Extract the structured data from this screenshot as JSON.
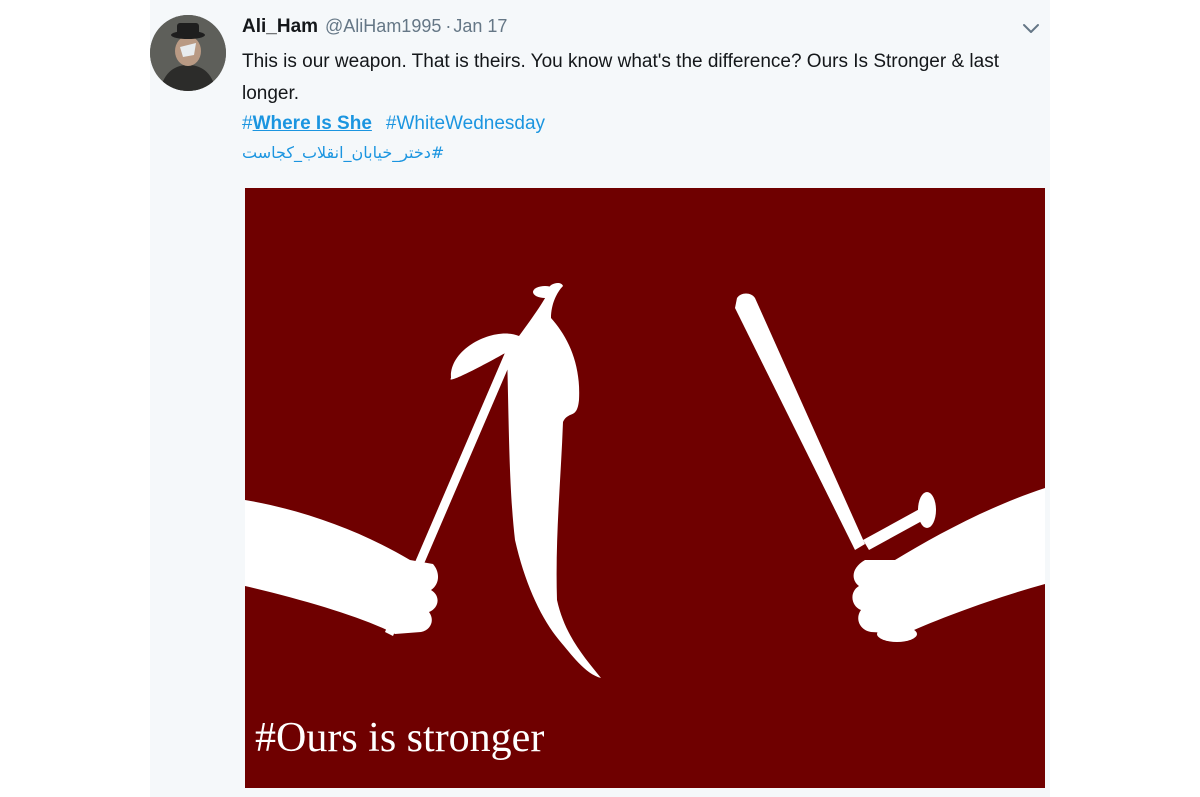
{
  "tweet": {
    "display_name": "Ali_Ham",
    "handle": "@AliHam1995",
    "separator": "·",
    "timestamp": "Jan 17",
    "text": "This is our weapon. That is theirs. You know what's the difference? Ours Is Stronger & last longer.",
    "hashtags": [
      {
        "prefix": "#",
        "label": "Where Is She"
      },
      {
        "prefix": "",
        "label": "#WhiteWednesday"
      }
    ],
    "hashtag_persian": "#دختر_خیابان_انقلاب_کجاست",
    "menu_icon": "chevron-down-icon"
  },
  "media": {
    "caption": "#Ours is stronger",
    "background_color": "#6f0000"
  },
  "colors": {
    "link": "#1b95e0",
    "text": "#14171a",
    "muted": "#657786"
  }
}
